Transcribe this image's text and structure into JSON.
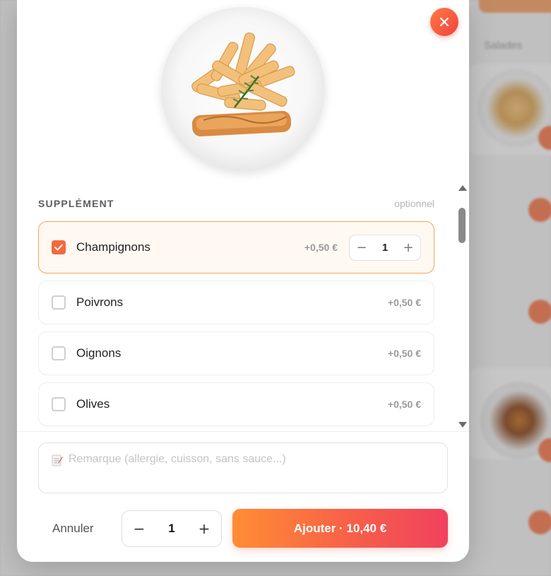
{
  "background": {
    "tab_label": "Salades"
  },
  "modal": {
    "close_icon": "close-icon",
    "dish_image": "pasta-salmon-plate",
    "section": {
      "title": "SUPPLÉMENT",
      "optional_label": "optionnel"
    },
    "options": [
      {
        "label": "Champignons",
        "price": "+0,50 €",
        "checked": true,
        "quantity": "1"
      },
      {
        "label": "Poivrons",
        "price": "+0,50 €",
        "checked": false
      },
      {
        "label": "Oignons",
        "price": "+0,50 €",
        "checked": false
      },
      {
        "label": "Olives",
        "price": "+0,50 €",
        "checked": false
      }
    ],
    "option_stepper": {
      "minus": "−",
      "plus": "+"
    },
    "remark": {
      "icon": "memo-icon",
      "placeholder": "Remarque (allergie, cuisson, sans sauce...)",
      "value": ""
    },
    "footer": {
      "cancel_label": "Annuler",
      "quantity": "1",
      "minus": "−",
      "plus": "+",
      "add_label": "Ajouter · 10,40 €"
    }
  },
  "colors": {
    "accent": "#f26a3c",
    "selected_border": "#f2a45e",
    "selected_bg": "#fff9f2",
    "button_gradient_start": "#ff8d34",
    "button_gradient_end": "#f1415e"
  }
}
